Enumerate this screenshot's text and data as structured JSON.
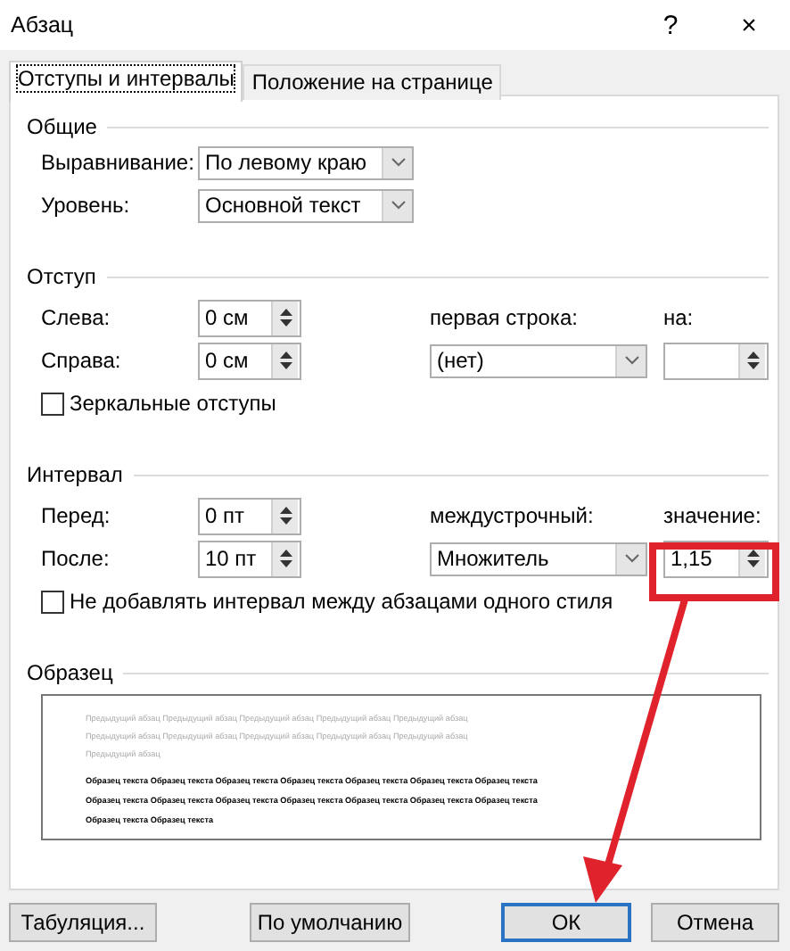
{
  "window": {
    "title": "Абзац",
    "help": "?",
    "close": "×"
  },
  "tabs": [
    {
      "label": "Отступы и интервалы",
      "selected": true
    },
    {
      "label": "Положение на странице",
      "selected": false
    }
  ],
  "general": {
    "title": "Общие",
    "rows": [
      {
        "label": "Выравнивание:",
        "value": "По левому краю"
      },
      {
        "label": "Уровень:",
        "value": "Основной текст"
      }
    ]
  },
  "indent": {
    "title": "Отступ",
    "first": {
      "label": "Слева:",
      "value": "0 см"
    },
    "second": {
      "label": "Справа:",
      "value": "0 см"
    },
    "mode": {
      "label": "первая строка:",
      "value": "(нет)"
    },
    "amount": {
      "label": "на:"
    },
    "option": {
      "label": "Зеркальные отступы",
      "checked": false
    }
  },
  "spacing": {
    "title": "Интервал",
    "first": {
      "label": "Перед:",
      "value": "0 пт"
    },
    "second": {
      "label": "После:",
      "value": "10 пт"
    },
    "mode": {
      "label": "междустрочный:",
      "value": "Множитель"
    },
    "amount": {
      "label": "значение:",
      "value": "1,15"
    },
    "option": {
      "label": "Не добавлять интервал между абзацами одного стиля",
      "checked": false
    }
  },
  "preview": {
    "title": "Образец",
    "previous_lines": [
      "Предыдущий абзац Предыдущий абзац Предыдущий абзац Предыдущий абзац Предыдущий абзац",
      "Предыдущий абзац Предыдущий абзац Предыдущий абзац Предыдущий абзац Предыдущий абзац",
      "Предыдущий абзац"
    ],
    "sample_lines": [
      "Образец текста Образец текста Образец текста Образец текста Образец текста Образец текста Образец текста",
      "Образец текста Образец текста Образец текста Образец текста Образец текста Образец текста Образец текста",
      "Образец текста Образец текста"
    ]
  },
  "buttons": [
    {
      "label": "Табуляция...",
      "default": false
    },
    {
      "label": "По умолчанию",
      "default": false
    },
    {
      "label": "ОК",
      "default": true
    },
    {
      "label": "Отмена",
      "default": false
    }
  ]
}
